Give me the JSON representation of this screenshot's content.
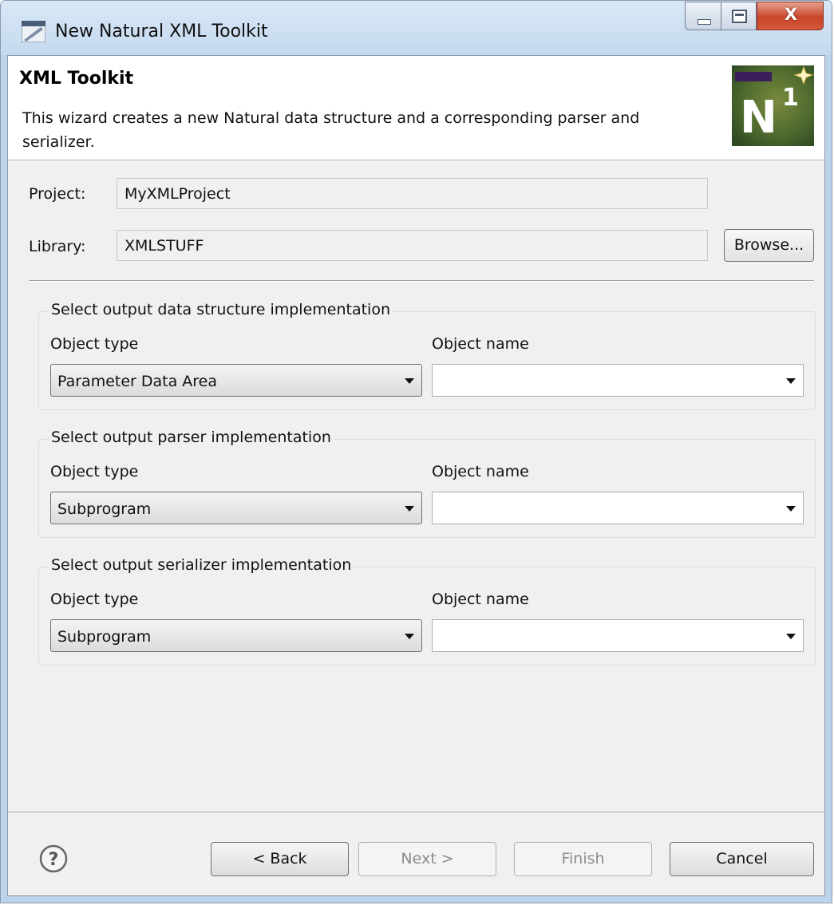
{
  "window": {
    "title": "New Natural XML Toolkit",
    "close_glyph": "X"
  },
  "banner": {
    "title": "XML Toolkit",
    "description": "This wizard creates a new Natural data structure and a corresponding parser and serializer.",
    "logo_icon": "natural-n1-logo-icon",
    "logo_text": "N1"
  },
  "form": {
    "project_label": "Project:",
    "project_value": "MyXMLProject",
    "library_label": "Library:",
    "library_value": "XMLSTUFF",
    "browse_label": "Browse..."
  },
  "groups": [
    {
      "title": "Select output data structure implementation",
      "type_label": "Object type",
      "name_label": "Object name",
      "type_value": "Parameter Data Area",
      "name_value": ""
    },
    {
      "title": "Select output parser implementation",
      "type_label": "Object type",
      "name_label": "Object name",
      "type_value": "Subprogram",
      "name_value": ""
    },
    {
      "title": "Select output serializer implementation",
      "type_label": "Object type",
      "name_label": "Object name",
      "type_value": "Subprogram",
      "name_value": ""
    }
  ],
  "buttons": {
    "back": "< Back",
    "next": "Next >",
    "finish": "Finish",
    "cancel": "Cancel"
  },
  "help_icon": "question-mark-icon",
  "colors": {
    "close_button": "#c8452b",
    "title_bar": "#c4d9ef",
    "dialog_bg": "#f0f0f0"
  }
}
